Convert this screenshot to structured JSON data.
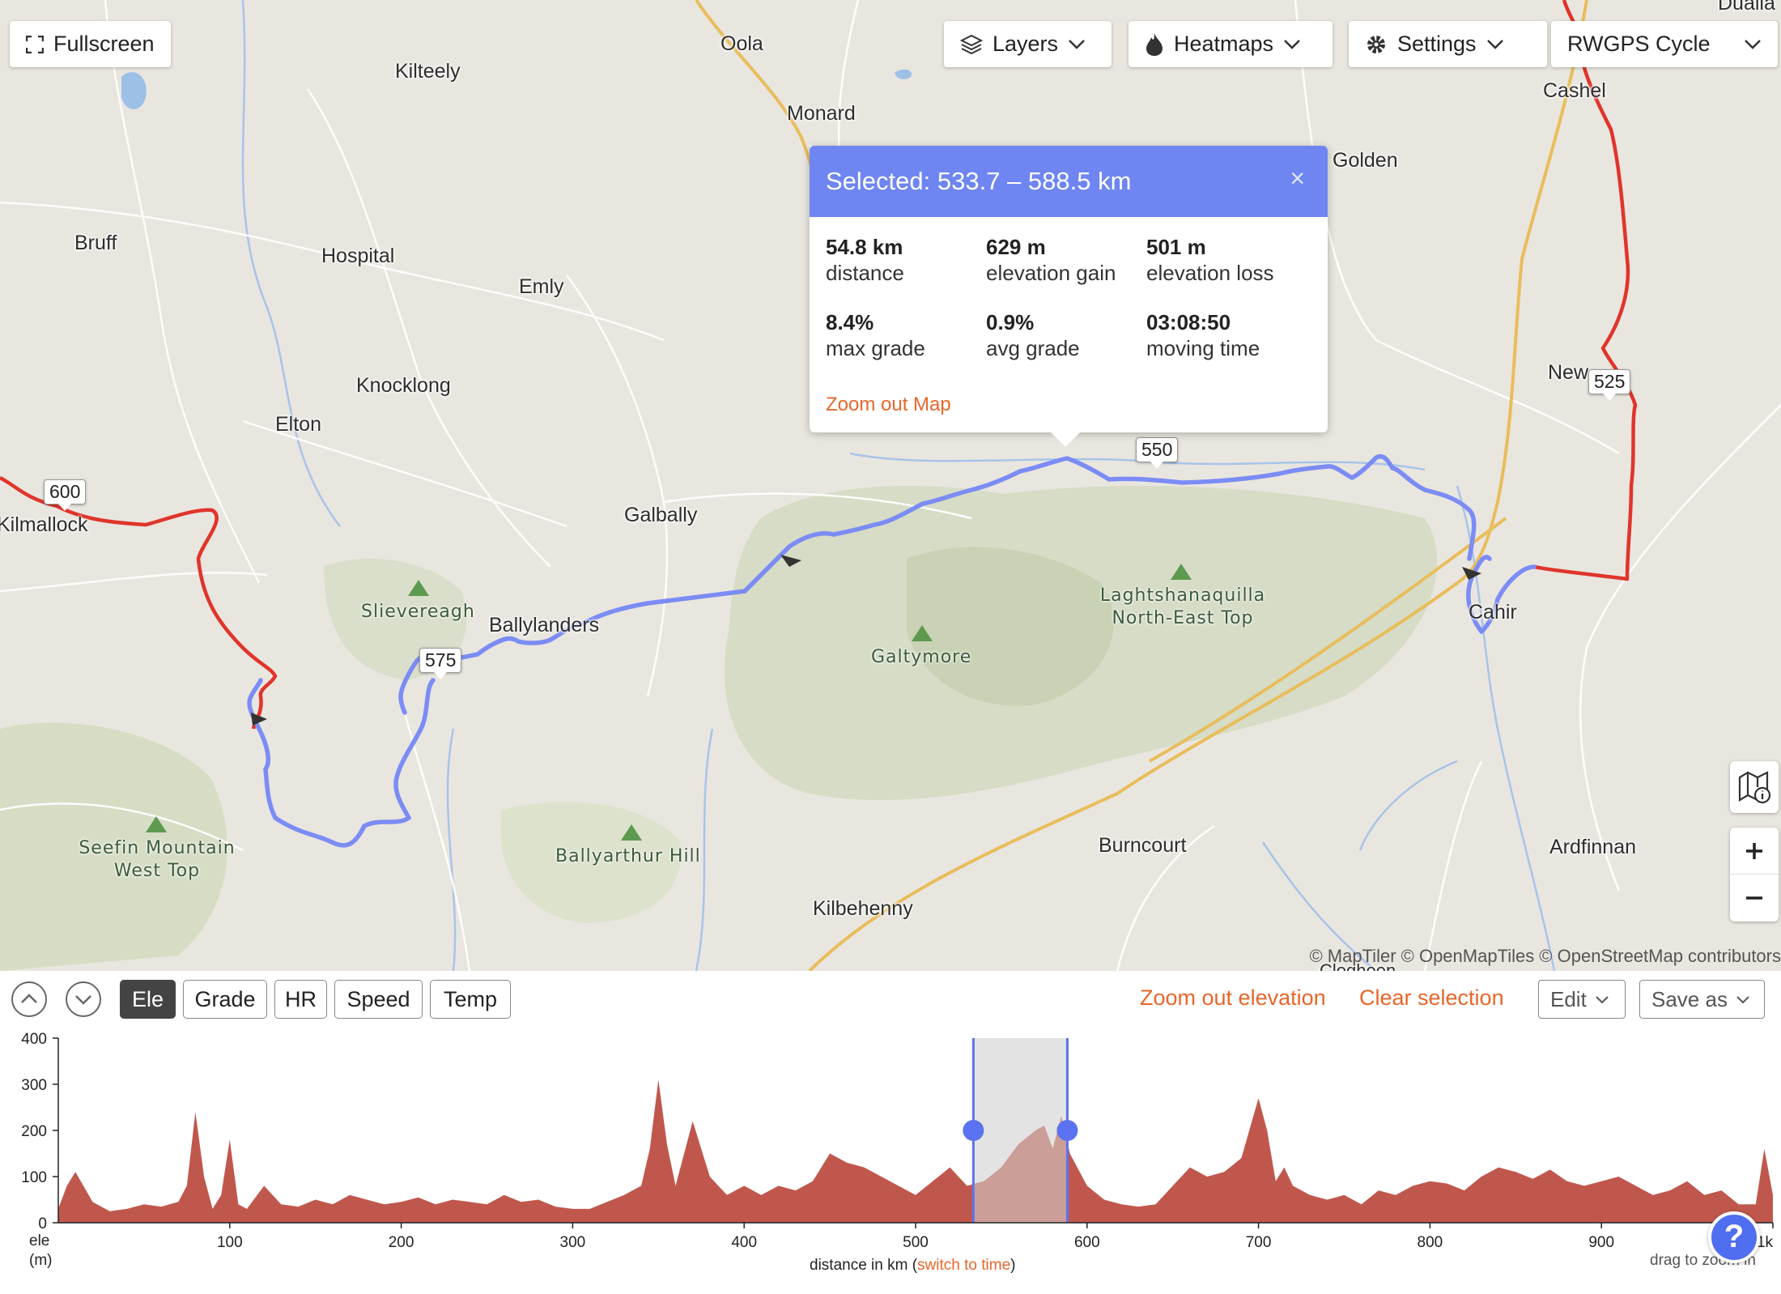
{
  "toolbar": {
    "fullscreen_label": "Fullscreen",
    "layers_label": "Layers",
    "heatmaps_label": "Heatmaps",
    "settings_label": "Settings",
    "basemap_label": "RWGPS Cycle"
  },
  "map": {
    "places": [
      "Oola",
      "Kilteely",
      "Monard",
      "Cashel",
      "Golden",
      "Bruff",
      "Hospital",
      "Emly",
      "Knocklong",
      "Elton",
      "Galbally",
      "Ballylanders",
      "Cahir",
      "Burncourt",
      "Ardfinnan",
      "Kilbehenny",
      "Kilmallock",
      "New",
      "Clogheen",
      "Dualla"
    ],
    "peaks": [
      "Slievereagh",
      "Galtymore",
      "Laghtshanaquilla North-East Top",
      "Seefin Mountain West Top",
      "Ballyarthur Hill"
    ],
    "km_markers": [
      "600",
      "575",
      "550",
      "525"
    ],
    "attribution": "© MapTiler © OpenMapTiles © OpenStreetMap contributors",
    "route_color": "#7b8cf5",
    "track_color": "#e03a2f"
  },
  "popup": {
    "title": "Selected: 533.7 – 588.5 km",
    "close": "×",
    "stats": [
      {
        "value": "54.8 km",
        "label": "distance"
      },
      {
        "value": "629 m",
        "label": "elevation gain"
      },
      {
        "value": "501 m",
        "label": "elevation loss"
      },
      {
        "value": "8.4%",
        "label": "max grade"
      },
      {
        "value": "0.9%",
        "label": "avg grade"
      },
      {
        "value": "03:08:50",
        "label": "moving time"
      }
    ],
    "zoom_out_map": "Zoom out Map"
  },
  "profile_bar": {
    "tabs": [
      "Ele",
      "Grade",
      "HR",
      "Speed",
      "Temp"
    ],
    "active_tab": "Ele",
    "zoom_out_elevation": "Zoom out elevation",
    "clear_selection": "Clear selection",
    "edit_label": "Edit",
    "save_as_label": "Save as"
  },
  "chart_data": {
    "type": "area",
    "ylabel_line1": "ele",
    "ylabel_line2": "(m)",
    "xlabel_prefix": "distance in km (",
    "xlabel_link": "switch to time",
    "xlabel_suffix": ")",
    "hint": "drag to zoom in",
    "y_ticks": [
      "400",
      "300",
      "200",
      "100",
      "0"
    ],
    "x_ticks": [
      "100",
      "200",
      "300",
      "400",
      "500",
      "600",
      "700",
      "800",
      "900",
      "1k"
    ],
    "ylim": [
      0,
      400
    ],
    "xlim": [
      0,
      1000
    ],
    "selection": [
      533.7,
      588.5
    ],
    "fill_color": "#c0574d",
    "selection_fill": "#cc9e98",
    "x": [
      0,
      5,
      10,
      20,
      30,
      40,
      50,
      60,
      70,
      75,
      80,
      85,
      90,
      95,
      100,
      105,
      110,
      120,
      130,
      140,
      150,
      160,
      170,
      180,
      190,
      200,
      210,
      220,
      230,
      240,
      250,
      260,
      270,
      280,
      290,
      300,
      310,
      320,
      330,
      340,
      345,
      350,
      355,
      360,
      370,
      380,
      390,
      400,
      410,
      420,
      430,
      440,
      450,
      460,
      470,
      480,
      490,
      500,
      510,
      520,
      530,
      540,
      550,
      560,
      570,
      575,
      580,
      585,
      590,
      600,
      610,
      620,
      630,
      640,
      650,
      660,
      670,
      680,
      690,
      700,
      705,
      710,
      715,
      720,
      730,
      740,
      750,
      760,
      770,
      780,
      790,
      800,
      810,
      820,
      830,
      840,
      850,
      860,
      870,
      880,
      890,
      900,
      910,
      920,
      930,
      940,
      950,
      960,
      970,
      980,
      990,
      995,
      1000
    ],
    "y": [
      30,
      80,
      110,
      45,
      25,
      30,
      40,
      35,
      45,
      80,
      240,
      100,
      30,
      60,
      180,
      40,
      30,
      80,
      40,
      35,
      50,
      40,
      60,
      50,
      40,
      45,
      55,
      40,
      50,
      45,
      40,
      60,
      45,
      50,
      35,
      30,
      30,
      45,
      60,
      80,
      160,
      310,
      170,
      80,
      220,
      100,
      60,
      80,
      60,
      80,
      70,
      90,
      150,
      130,
      120,
      100,
      80,
      60,
      90,
      120,
      80,
      90,
      120,
      170,
      200,
      210,
      160,
      230,
      150,
      80,
      50,
      40,
      35,
      40,
      80,
      120,
      100,
      110,
      140,
      270,
      200,
      90,
      120,
      80,
      60,
      50,
      60,
      40,
      70,
      60,
      80,
      90,
      85,
      70,
      100,
      120,
      110,
      95,
      115,
      90,
      80,
      90,
      100,
      80,
      60,
      70,
      90,
      60,
      70,
      40,
      40,
      160,
      60
    ]
  }
}
